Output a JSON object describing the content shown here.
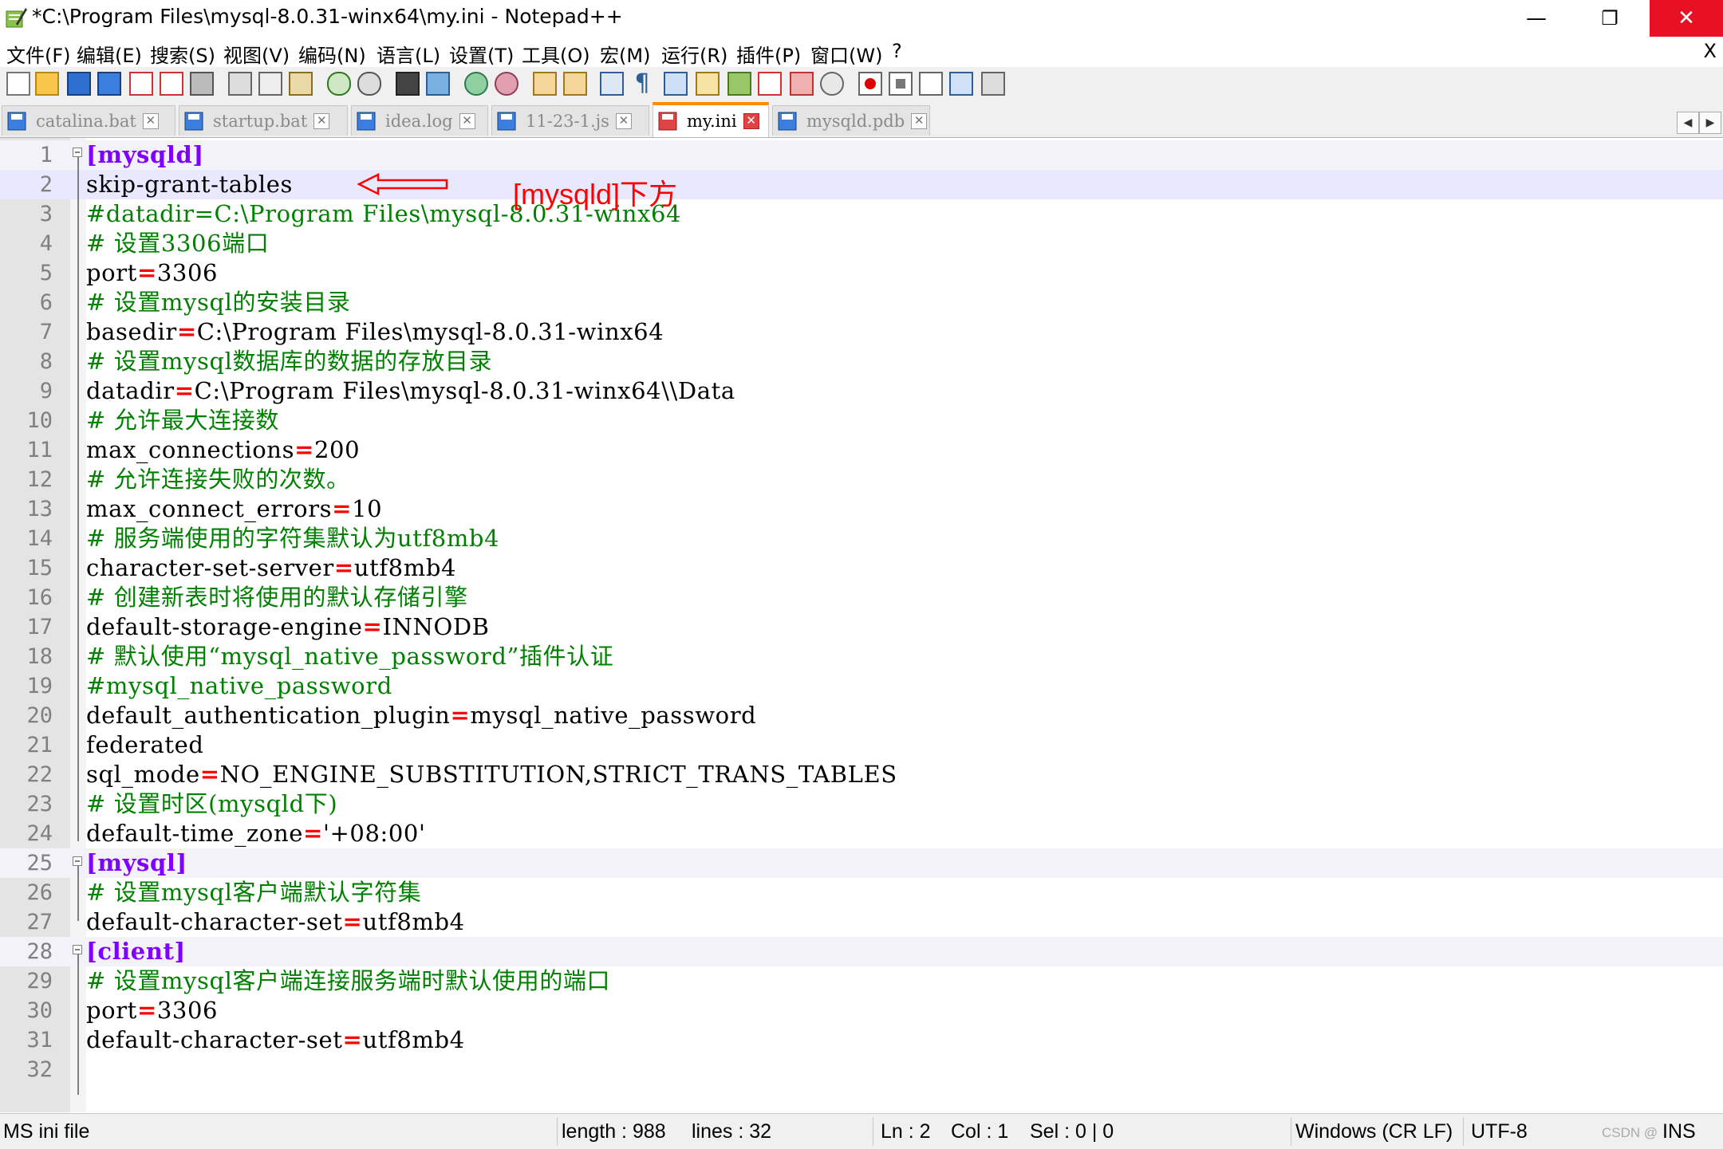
{
  "window": {
    "title": "*C:\\Program Files\\mysql-8.0.31-winx64\\my.ini - Notepad++",
    "minimize_glyph": "—",
    "restore_glyph": "❐",
    "close_glyph": "✕"
  },
  "menu": {
    "items": [
      "文件(F)",
      "编辑(E)",
      "搜索(S)",
      "视图(V)",
      "编码(N)",
      "语言(L)",
      "设置(T)",
      "工具(O)",
      "宏(M)",
      "运行(R)",
      "插件(P)",
      "窗口(W)",
      "?"
    ],
    "close_label": "X"
  },
  "toolbar": {
    "icons": [
      "new-file-icon",
      "open-file-icon",
      "save-icon",
      "save-all-icon",
      "close-icon",
      "close-all-icon",
      "print-icon",
      "cut-icon",
      "copy-icon",
      "paste-icon",
      "undo-icon",
      "redo-icon",
      "find-icon",
      "replace-icon",
      "zoom-in-icon",
      "zoom-out-icon",
      "sync-vertical-icon",
      "sync-horizontal-icon",
      "word-wrap-icon",
      "show-all-chars-icon",
      "indent-guide-icon",
      "doc-map-icon",
      "function-list-icon",
      "folder-workspace-icon",
      "monitoring-icon",
      "record-macro-icon",
      "stop-record-icon",
      "play-macro-icon",
      "run-macro-multiple-icon",
      "save-macro-icon"
    ]
  },
  "tabs": [
    {
      "label": "catalina.bat",
      "active": false,
      "saved": true
    },
    {
      "label": "startup.bat",
      "active": false,
      "saved": true
    },
    {
      "label": "idea.log",
      "active": false,
      "saved": true
    },
    {
      "label": "11-23-1.js",
      "active": false,
      "saved": true
    },
    {
      "label": "my.ini",
      "active": true,
      "saved": false
    },
    {
      "label": "mysqld.pdb",
      "active": false,
      "saved": true
    }
  ],
  "tab_scroll": {
    "left": "◀",
    "right": "▶"
  },
  "editor": {
    "current_line": 2,
    "lines": [
      {
        "n": "1",
        "text": "[mysqld]",
        "kind": "section"
      },
      {
        "n": "2",
        "text": "skip-grant-tables",
        "kind": "plain"
      },
      {
        "n": "3",
        "text": "#datadir=C:\\Program Files\\mysql-8.0.31-winx64",
        "kind": "comment"
      },
      {
        "n": "4",
        "text": "# 设置3306端口",
        "kind": "comment"
      },
      {
        "n": "5",
        "text": "port=3306",
        "kind": "kv"
      },
      {
        "n": "6",
        "text": "# 设置mysql的安装目录",
        "kind": "comment"
      },
      {
        "n": "7",
        "text": "basedir=C:\\Program Files\\mysql-8.0.31-winx64",
        "kind": "kv"
      },
      {
        "n": "8",
        "text": "# 设置mysql数据库的数据的存放目录",
        "kind": "comment"
      },
      {
        "n": "9",
        "text": "datadir=C:\\Program Files\\mysql-8.0.31-winx64\\\\Data",
        "kind": "kv"
      },
      {
        "n": "10",
        "text": "# 允许最大连接数",
        "kind": "comment"
      },
      {
        "n": "11",
        "text": "max_connections=200",
        "kind": "kv"
      },
      {
        "n": "12",
        "text": "# 允许连接失败的次数。",
        "kind": "comment"
      },
      {
        "n": "13",
        "text": "max_connect_errors=10",
        "kind": "kv"
      },
      {
        "n": "14",
        "text": "# 服务端使用的字符集默认为utf8mb4",
        "kind": "comment"
      },
      {
        "n": "15",
        "text": "character-set-server=utf8mb4",
        "kind": "kv"
      },
      {
        "n": "16",
        "text": "# 创建新表时将使用的默认存储引擎",
        "kind": "comment"
      },
      {
        "n": "17",
        "text": "default-storage-engine=INNODB",
        "kind": "kv"
      },
      {
        "n": "18",
        "text": "# 默认使用“mysql_native_password”插件认证",
        "kind": "comment"
      },
      {
        "n": "19",
        "text": "#mysql_native_password",
        "kind": "comment"
      },
      {
        "n": "20",
        "text": "default_authentication_plugin=mysql_native_password",
        "kind": "kv"
      },
      {
        "n": "21",
        "text": "federated",
        "kind": "plain"
      },
      {
        "n": "22",
        "text": "sql_mode=NO_ENGINE_SUBSTITUTION,STRICT_TRANS_TABLES",
        "kind": "kv"
      },
      {
        "n": "23",
        "text": "# 设置时区(mysqld下)",
        "kind": "comment"
      },
      {
        "n": "24",
        "text": "default-time_zone='+08:00'",
        "kind": "kv"
      },
      {
        "n": "25",
        "text": "[mysql]",
        "kind": "section"
      },
      {
        "n": "26",
        "text": "# 设置mysql客户端默认字符集",
        "kind": "comment"
      },
      {
        "n": "27",
        "text": "default-character-set=utf8mb4",
        "kind": "kv"
      },
      {
        "n": "28",
        "text": "[client]",
        "kind": "section"
      },
      {
        "n": "29",
        "text": "# 设置mysql客户端连接服务端时默认使用的端口",
        "kind": "comment"
      },
      {
        "n": "30",
        "text": "port=3306",
        "kind": "kv"
      },
      {
        "n": "31",
        "text": "default-character-set=utf8mb4",
        "kind": "kv"
      },
      {
        "n": "32",
        "text": "",
        "kind": "plain"
      }
    ],
    "annotation": "[mysqld]下方"
  },
  "status": {
    "file_type": "MS ini file",
    "length": "length : 988",
    "lines": "lines : 32",
    "ln": "Ln : 2",
    "col": "Col : 1",
    "sel": "Sel : 0 | 0",
    "eol": "Windows (CR LF)",
    "encoding": "UTF-8",
    "mode": "INS",
    "watermark": "CSDN @"
  },
  "colors": {
    "section": "#8000ff",
    "comment": "#008000",
    "operator": "#ff0000",
    "annotation": "#ff0000",
    "active_tab_accent": "#fa8c00",
    "current_line": "#e8e8ff"
  }
}
